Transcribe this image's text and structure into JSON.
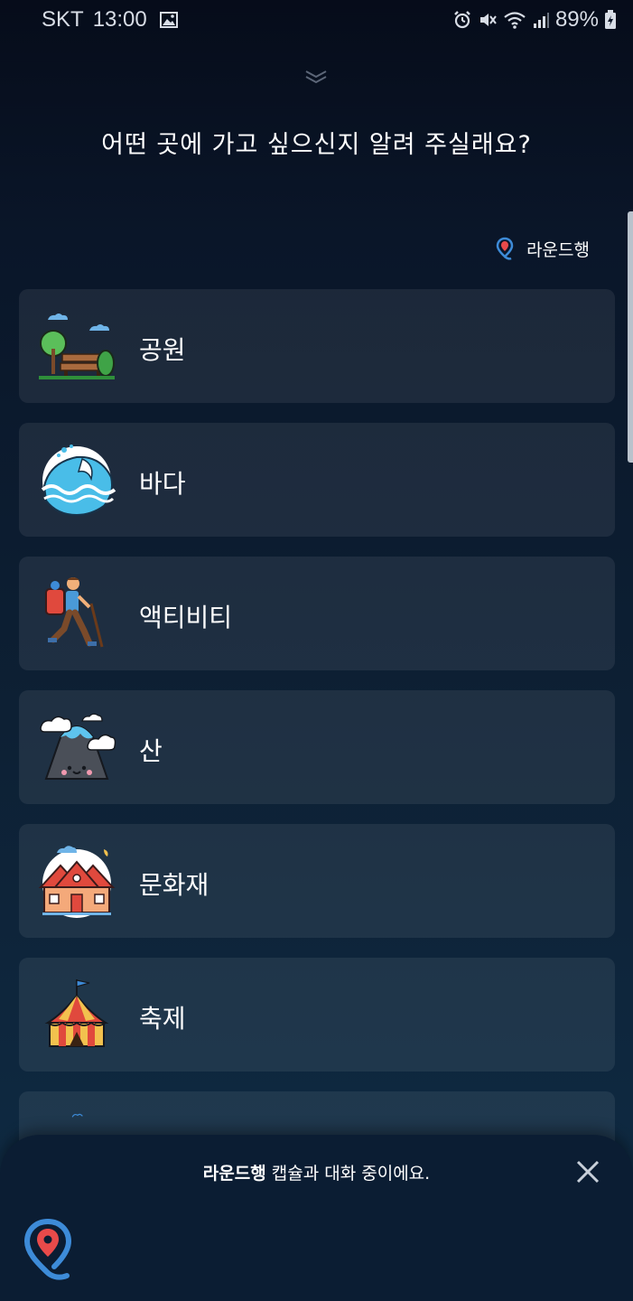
{
  "status_bar": {
    "carrier": "SKT",
    "time": "13:00",
    "battery": "89%"
  },
  "header": {
    "title": "어떤 곳에 가고 싶으신지 알려 주실래요?"
  },
  "capsule_tag": {
    "label": "라운드행"
  },
  "categories": [
    {
      "label": "공원",
      "icon": "park-icon"
    },
    {
      "label": "바다",
      "icon": "sea-wave-icon"
    },
    {
      "label": "액티비티",
      "icon": "hiker-icon"
    },
    {
      "label": "산",
      "icon": "mountain-icon"
    },
    {
      "label": "문화재",
      "icon": "heritage-house-icon"
    },
    {
      "label": "축제",
      "icon": "circus-tent-icon"
    }
  ],
  "bottom_sheet": {
    "capsule_name": "라운드행",
    "message_suffix": " 캡슐과 대화 중이에요."
  },
  "colors": {
    "accent_blue": "#3d8bd8",
    "pin_red": "#e84a4a",
    "card_bg": "#1c2b42"
  }
}
